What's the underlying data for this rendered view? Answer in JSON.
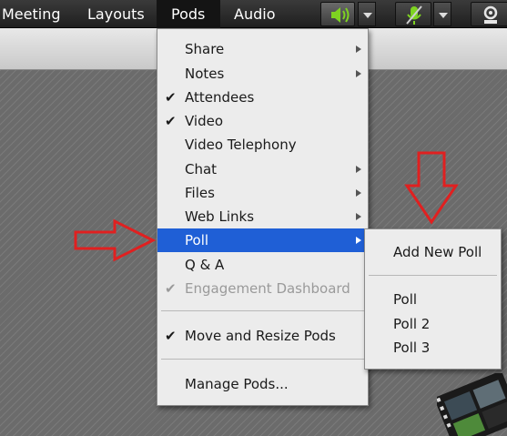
{
  "menubar": {
    "items": [
      "Meeting",
      "Layouts",
      "Pods",
      "Audio"
    ],
    "speaker_icon": "speaker-icon",
    "mic_icon": "microphone-muted-icon",
    "camera_icon": "webcam-icon",
    "accent": "#7ed321"
  },
  "pods_menu": {
    "items": [
      {
        "label": "Share",
        "checked": false,
        "submenu": true,
        "disabled": false
      },
      {
        "label": "Notes",
        "checked": false,
        "submenu": true,
        "disabled": false
      },
      {
        "label": "Attendees",
        "checked": true,
        "submenu": false,
        "disabled": false
      },
      {
        "label": "Video",
        "checked": true,
        "submenu": false,
        "disabled": false
      },
      {
        "label": "Video Telephony",
        "checked": false,
        "submenu": false,
        "disabled": false
      },
      {
        "label": "Chat",
        "checked": false,
        "submenu": true,
        "disabled": false
      },
      {
        "label": "Files",
        "checked": false,
        "submenu": true,
        "disabled": false
      },
      {
        "label": "Web Links",
        "checked": false,
        "submenu": true,
        "disabled": false
      },
      {
        "label": "Poll",
        "checked": false,
        "submenu": true,
        "disabled": false,
        "selected": true
      },
      {
        "label": "Q & A",
        "checked": false,
        "submenu": false,
        "disabled": false
      },
      {
        "label": "Engagement Dashboard",
        "checked": true,
        "submenu": false,
        "disabled": true
      },
      {
        "label": "Move and Resize Pods",
        "checked": true,
        "submenu": false,
        "disabled": false
      },
      {
        "label": "Manage Pods...",
        "checked": false,
        "submenu": false,
        "disabled": false
      }
    ],
    "check_glyph": "✔"
  },
  "poll_submenu": {
    "items": [
      "Add New Poll",
      "Poll",
      "Poll 2",
      "Poll 3"
    ]
  },
  "colors": {
    "selection": "#1f5fd6",
    "annotation_arrow": "#e02020"
  }
}
